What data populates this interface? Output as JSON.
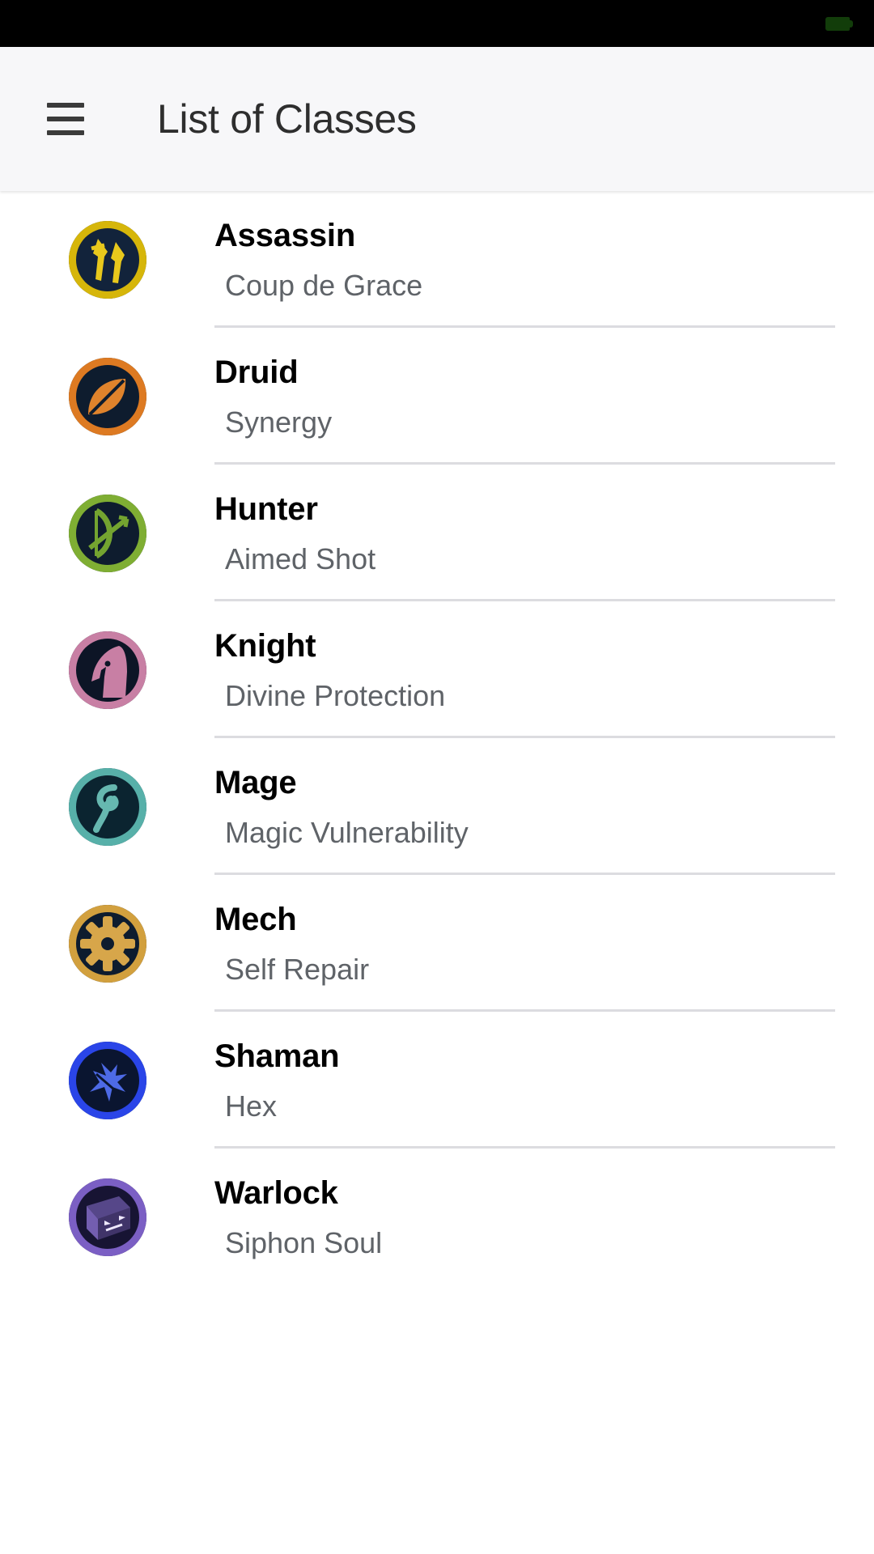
{
  "status_bar": {
    "battery_icon": "battery-icon",
    "battery_color": "#123d0a"
  },
  "app_bar": {
    "menu_icon": "hamburger-menu-icon",
    "title": "List of Classes",
    "background": "#f7f7f9"
  },
  "classes": [
    {
      "name": "Assassin",
      "skill": "Coup de Grace",
      "icon": "assassin-icon",
      "ring_color": "#d6b60a",
      "glyph_color": "#e8c81c",
      "bg_color": "#12233b"
    },
    {
      "name": "Druid",
      "skill": "Synergy",
      "icon": "druid-icon",
      "ring_color": "#dd7a22",
      "glyph_color": "#df832c",
      "bg_color": "#0e1c2e"
    },
    {
      "name": "Hunter",
      "skill": "Aimed Shot",
      "icon": "hunter-icon",
      "ring_color": "#7fae33",
      "glyph_color": "#74a430",
      "bg_color": "#0e1c2e"
    },
    {
      "name": "Knight",
      "skill": "Divine Protection",
      "icon": "knight-icon",
      "ring_color": "#c87fa4",
      "glyph_color": "#c87fa4",
      "bg_color": "#0d1526"
    },
    {
      "name": "Mage",
      "skill": "Magic Vulnerability",
      "icon": "mage-icon",
      "ring_color": "#57b0a9",
      "glyph_color": "#66b8b0",
      "bg_color": "#0b2430"
    },
    {
      "name": "Mech",
      "skill": "Self Repair",
      "icon": "mech-icon",
      "ring_color": "#d2a03e",
      "glyph_color": "#d7a64a",
      "bg_color": "#0e1c2e"
    },
    {
      "name": "Shaman",
      "skill": "Hex",
      "icon": "shaman-icon",
      "ring_color": "#2a45e8",
      "glyph_color": "#4d6ae6",
      "bg_color": "#0a1530"
    },
    {
      "name": "Warlock",
      "skill": "Siphon Soul",
      "icon": "warlock-icon",
      "ring_color": "#7b5fc4",
      "glyph_color": "#8b71cf",
      "bg_color": "#171433"
    }
  ]
}
